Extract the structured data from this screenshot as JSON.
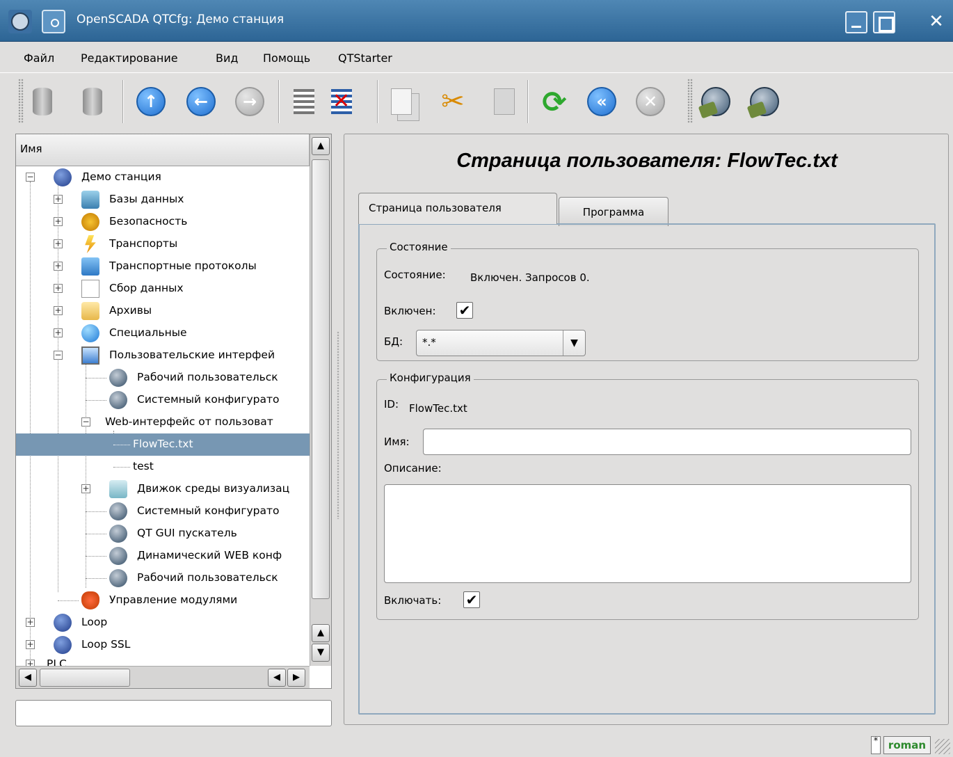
{
  "window": {
    "title": "OpenSCADA QTCfg: Демо станция"
  },
  "menu": {
    "file": "Файл",
    "edit": "Редактирование",
    "view": "Вид",
    "help": "Помощь",
    "qtstarter": "QTStarter"
  },
  "tree": {
    "header": "Имя",
    "items": [
      "Демо станция",
      "Базы данных",
      "Безопасность",
      "Транспорты",
      "Транспортные протоколы",
      "Сбор данных",
      "Архивы",
      "Специальные",
      "Пользовательские интерфей",
      "Рабочий пользовательск",
      "Системный конфигурато",
      "Web-интерфейс от пользоват",
      "FlowTec.txt",
      "test",
      "Движок среды визуализац",
      "Системный конфигурато",
      "QT GUI пускатель",
      "Динамический WEB конф",
      "Рабочий пользовательск",
      "Управление модулями",
      "Loop",
      "Loop SSL",
      "PLC"
    ]
  },
  "page": {
    "title": "Страница пользователя: FlowTec.txt",
    "tabs": [
      "Страница пользователя",
      "Программа"
    ],
    "state_group": {
      "title": "Состояние",
      "state_label": "Состояние:",
      "state_value": "Включен. Запросов 0.",
      "enabled_label": "Включен:",
      "db_label": "БД:",
      "db_value": "*.*"
    },
    "config_group": {
      "title": "Конфигурация",
      "id_label": "ID:",
      "id_value": "FlowTec.txt",
      "name_label": "Имя:",
      "name_value": "",
      "descr_label": "Описание:",
      "descr_value": "",
      "enable_label": "Включать:"
    }
  },
  "status": {
    "modified": "*",
    "user": "roman"
  },
  "colors": {
    "titlebar": "#2d6595",
    "selection": "#7797b3",
    "user_badge_text": "#2d8a2d"
  }
}
